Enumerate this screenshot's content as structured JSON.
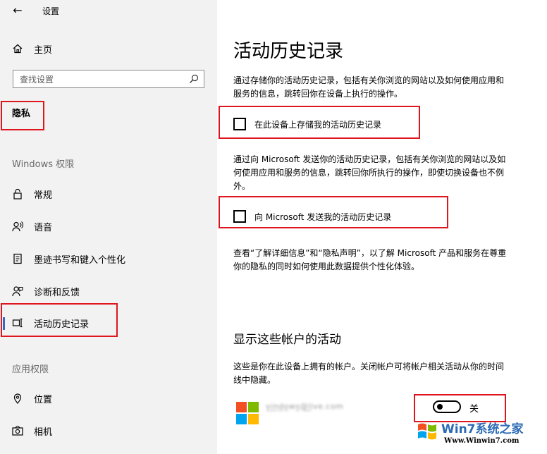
{
  "window": {
    "back_glyph": "←",
    "title": "设置"
  },
  "sidebar": {
    "home": {
      "label": "主页",
      "icon": "home-icon"
    },
    "search": {
      "placeholder": "查找设置",
      "icon": "search-icon"
    },
    "privacy_heading": "隐私",
    "windows_section": {
      "heading": "Windows 权限",
      "items": [
        {
          "label": "常规",
          "icon": "lock-icon"
        },
        {
          "label": "语音",
          "icon": "speech-icon"
        },
        {
          "label": "墨迹书写和键入个性化",
          "icon": "inking-icon"
        },
        {
          "label": "诊断和反馈",
          "icon": "feedback-icon"
        },
        {
          "label": "活动历史记录",
          "icon": "timeline-icon",
          "active": true
        }
      ]
    },
    "app_section": {
      "heading": "应用权限",
      "items": [
        {
          "label": "位置",
          "icon": "location-icon"
        },
        {
          "label": "相机",
          "icon": "camera-icon"
        }
      ]
    }
  },
  "main": {
    "title": "活动历史记录",
    "intro_line1": "通过存储你的活动历史记录，包括有关你浏览的网站以及如何使用应用和",
    "intro_line2": "服务的信息，跳转回你在设备上执行的操作。",
    "store_checkbox": {
      "label": "在此设备上存储我的活动历史记录",
      "checked": false
    },
    "send_line1": "通过向 Microsoft 发送你的活动历史记录，包括有关你浏览的网站以及如",
    "send_line2": "何使用应用和服务的信息，跳转回你所执行的操作，即使切换设备也不例",
    "send_line3": "外。",
    "send_checkbox": {
      "label": "向 Microsoft 发送我的活动历史记录",
      "checked": false
    },
    "info_line1": "查看“了解详细信息”和“隐私声明”，以了解 Microsoft 产品和服务在尊重",
    "info_line2": "你的隐私的同时如何使用此数据提供个性化体验。",
    "accounts_heading": "显示这些帐户的活动",
    "accounts_line1": "这些是你在此设备上拥有的帐户。关闭帐户可将帐户相关活动从你的时间",
    "accounts_line2": "线中隐藏。",
    "account": {
      "name": "v̲i̲n̲d̲o̲ws̲@̲l̲ive.com",
      "logo_colors": [
        "#f25022",
        "#7fba00",
        "#00a4ef",
        "#ffb900"
      ],
      "toggle_on": false,
      "toggle_label": "关"
    }
  },
  "watermark": {
    "brand": "Win7系统之家",
    "url": "Www.Winwin7.com"
  },
  "colors": {
    "highlight": "#e0161f",
    "sidebar_bg": "#f2f2f2",
    "accent": "#3a66c4"
  }
}
